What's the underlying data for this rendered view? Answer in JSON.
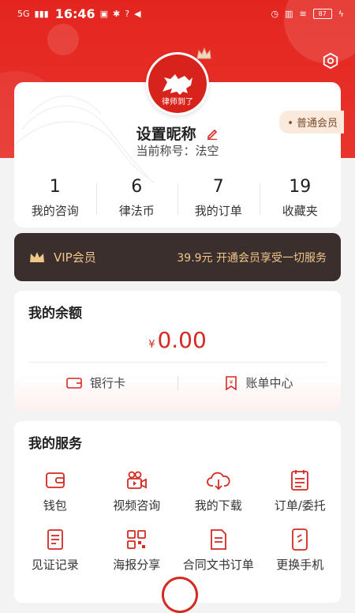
{
  "status_bar": {
    "network": "5G",
    "time": "16:46",
    "battery": "87"
  },
  "profile": {
    "nickname": "设置昵称",
    "current_name": "当前称号：法空",
    "badge": "• 普通会员",
    "logo_text": "律师到了"
  },
  "stats": [
    {
      "value": "1",
      "label": "我的咨询"
    },
    {
      "value": "6",
      "label": "律法币"
    },
    {
      "value": "7",
      "label": "我的订单"
    },
    {
      "value": "19",
      "label": "收藏夹"
    }
  ],
  "vip": {
    "title": "VIP会员",
    "desc": "39.9元 开通会员享受一切服务"
  },
  "balance": {
    "title": "我的余额",
    "currency": "¥",
    "amount": "0.00",
    "bank_card": "银行卡",
    "bill_center": "账单中心"
  },
  "services": {
    "title": "我的服务",
    "items": [
      {
        "label": "钱包",
        "icon": "wallet-icon"
      },
      {
        "label": "视频咨询",
        "icon": "video-icon"
      },
      {
        "label": "我的下载",
        "icon": "cloud-download-icon"
      },
      {
        "label": "订单/委托",
        "icon": "order-icon"
      },
      {
        "label": "见证记录",
        "icon": "document-icon"
      },
      {
        "label": "海报分享",
        "icon": "qrcode-icon"
      },
      {
        "label": "合同文书订单",
        "icon": "contract-icon"
      },
      {
        "label": "更换手机",
        "icon": "phone-icon"
      }
    ]
  },
  "colors": {
    "brand_red": "#e4251f",
    "vip_gold": "#f1c689",
    "vip_bg": "#3a2f2d"
  }
}
